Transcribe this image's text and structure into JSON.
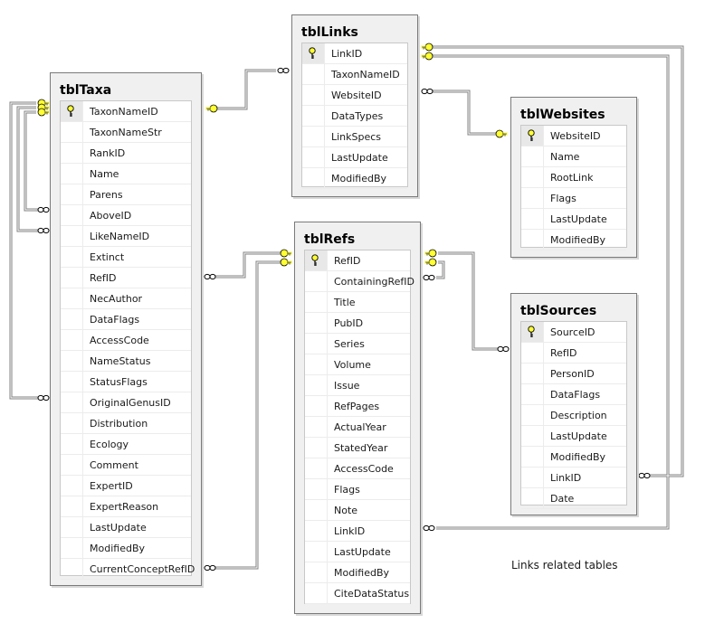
{
  "diagram": {
    "caption": "Links related tables",
    "colors": {
      "table_frame": "#f0f0f0",
      "table_border": "#7a7a7a",
      "key_yellow": "#ffff33",
      "connector": "#808080"
    },
    "tables": {
      "tblTaxa": {
        "title": "tblTaxa",
        "columns": [
          "TaxonNameID",
          "TaxonNameStr",
          "RankID",
          "Name",
          "Parens",
          "AboveID",
          "LikeNameID",
          "Extinct",
          "RefID",
          "NecAuthor",
          "DataFlags",
          "AccessCode",
          "NameStatus",
          "StatusFlags",
          "OriginalGenusID",
          "Distribution",
          "Ecology",
          "Comment",
          "ExpertID",
          "ExpertReason",
          "LastUpdate",
          "ModifiedBy",
          "CurrentConceptRefID"
        ],
        "primary_key": "TaxonNameID"
      },
      "tblLinks": {
        "title": "tblLinks",
        "columns": [
          "LinkID",
          "TaxonNameID",
          "WebsiteID",
          "DataTypes",
          "LinkSpecs",
          "LastUpdate",
          "ModifiedBy"
        ],
        "primary_key": "LinkID"
      },
      "tblWebsites": {
        "title": "tblWebsites",
        "columns": [
          "WebsiteID",
          "Name",
          "RootLink",
          "Flags",
          "LastUpdate",
          "ModifiedBy"
        ],
        "primary_key": "WebsiteID"
      },
      "tblRefs": {
        "title": "tblRefs",
        "columns": [
          "RefID",
          "ContainingRefID",
          "Title",
          "PubID",
          "Series",
          "Volume",
          "Issue",
          "RefPages",
          "ActualYear",
          "StatedYear",
          "AccessCode",
          "Flags",
          "Note",
          "LinkID",
          "LastUpdate",
          "ModifiedBy",
          "CiteDataStatus"
        ],
        "primary_key": "RefID"
      },
      "tblSources": {
        "title": "tblSources",
        "columns": [
          "SourceID",
          "RefID",
          "PersonID",
          "DataFlags",
          "Description",
          "LastUpdate",
          "ModifiedBy",
          "LinkID",
          "Date"
        ],
        "primary_key": "SourceID"
      }
    },
    "relationships": [
      {
        "from": "tblLinks.TaxonNameID",
        "to": "tblTaxa.TaxonNameID",
        "type": "many-to-one"
      },
      {
        "from": "tblLinks.WebsiteID",
        "to": "tblWebsites.WebsiteID",
        "type": "many-to-one"
      },
      {
        "from": "tblTaxa.RefID",
        "to": "tblRefs.RefID",
        "type": "many-to-one"
      },
      {
        "from": "tblTaxa.CurrentConceptRefID",
        "to": "tblRefs.RefID",
        "type": "many-to-one"
      },
      {
        "from": "tblTaxa.AboveID",
        "to": "tblTaxa.TaxonNameID",
        "type": "self"
      },
      {
        "from": "tblTaxa.LikeNameID",
        "to": "tblTaxa.TaxonNameID",
        "type": "self"
      },
      {
        "from": "tblTaxa.OriginalGenusID",
        "to": "tblTaxa.TaxonNameID",
        "type": "self"
      },
      {
        "from": "tblRefs.ContainingRefID",
        "to": "tblRefs.RefID",
        "type": "self"
      },
      {
        "from": "tblSources.RefID",
        "to": "tblRefs.RefID",
        "type": "many-to-one"
      },
      {
        "from": "tblSources.LinkID",
        "to": "tblLinks.LinkID",
        "type": "many-to-one"
      },
      {
        "from": "tblRefs.LinkID",
        "to": "tblLinks.LinkID",
        "type": "many-to-one"
      }
    ]
  }
}
